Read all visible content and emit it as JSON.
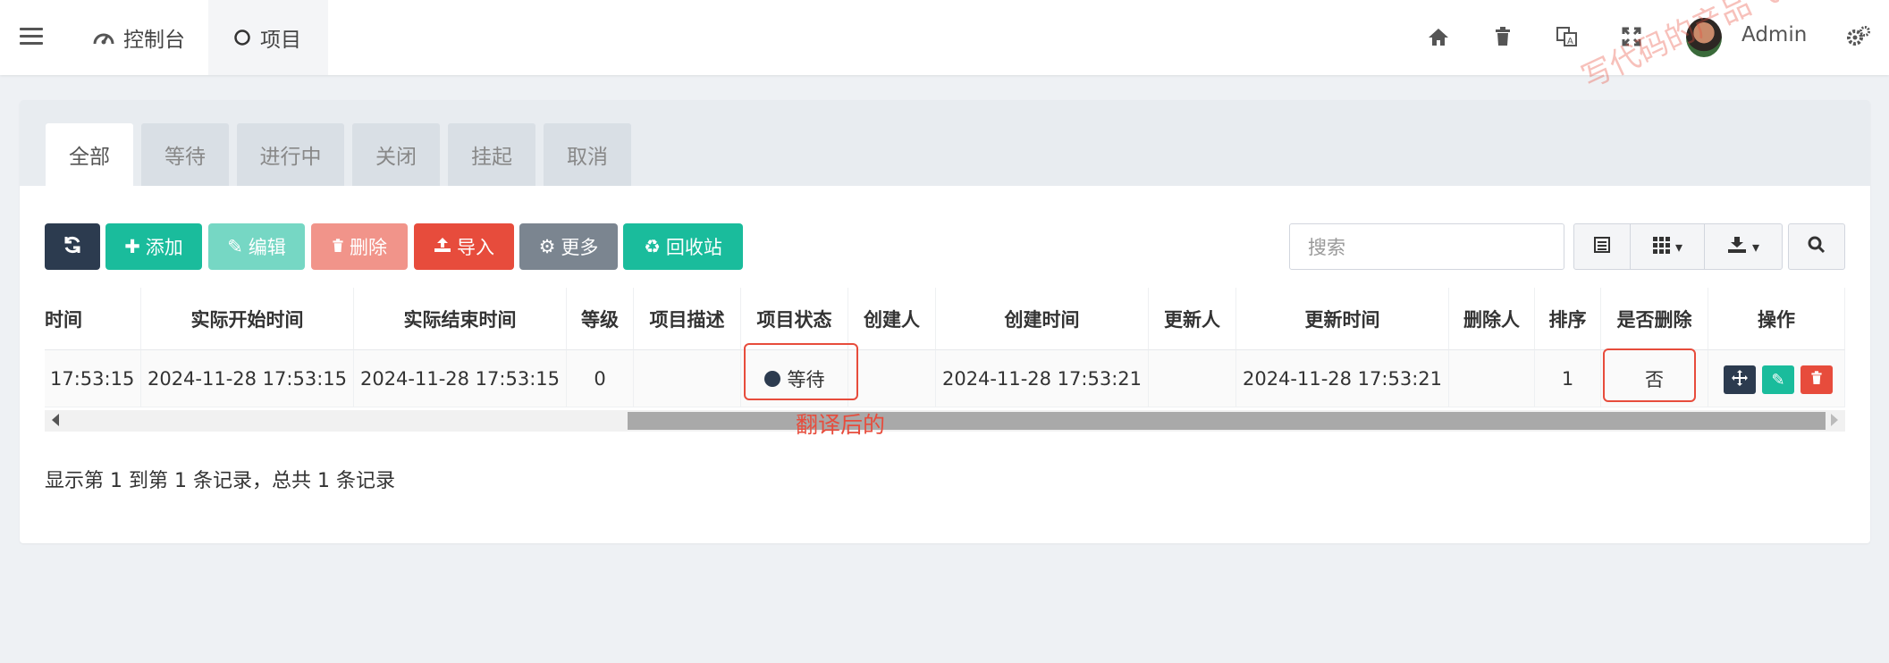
{
  "navbar": {
    "tabs": [
      {
        "label": "控制台",
        "icon": "dashboard-icon"
      },
      {
        "label": "项目",
        "icon": "circle-icon"
      }
    ],
    "right_icons": [
      "home-icon",
      "trash-icon",
      "translate-icon",
      "fullscreen-icon"
    ],
    "username": "Admin",
    "settings_icon": "gears-icon"
  },
  "watermark": "写代码的产品飞哥",
  "status_tabs": [
    "全部",
    "等待",
    "进行中",
    "关闭",
    "挂起",
    "取消"
  ],
  "toolbar": {
    "refresh_icon": "refresh-icon",
    "add_label": "添加",
    "edit_label": "编辑",
    "delete_label": "删除",
    "import_label": "导入",
    "more_label": "更多",
    "recycle_label": "回收站",
    "search_placeholder": "搜索"
  },
  "table": {
    "headers": [
      "时间",
      "实际开始时间",
      "实际结束时间",
      "等级",
      "项目描述",
      "项目状态",
      "创建人",
      "创建时间",
      "更新人",
      "更新时间",
      "删除人",
      "排序",
      "是否删除",
      "操作"
    ],
    "rows": [
      {
        "cells": [
          "17:53:15",
          "2024-11-28 17:53:15",
          "2024-11-28 17:53:15",
          "0",
          "",
          "等待",
          "",
          "2024-11-28 17:53:21",
          "",
          "2024-11-28 17:53:21",
          "",
          "1",
          "否",
          ""
        ]
      }
    ]
  },
  "pagination_text": "显示第 1 到第 1 条记录，总共 1 条记录",
  "annotation": "翻译后的",
  "colors": {
    "dark": "#2c3b4f",
    "green": "#1abc9c",
    "green_light": "#76d7c4",
    "red_light": "#f1948a",
    "red": "#e74c3c",
    "gray": "#7b8590",
    "annotation": "#e74c3c"
  }
}
